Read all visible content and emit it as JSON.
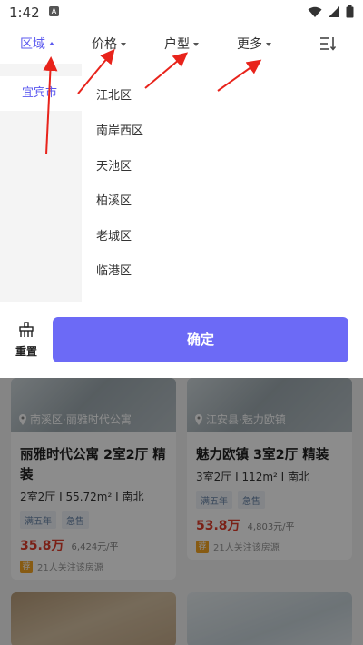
{
  "status_bar": {
    "time": "1:42",
    "app_icon": "A"
  },
  "filters": {
    "tabs": [
      {
        "label": "区域",
        "active": true
      },
      {
        "label": "价格",
        "active": false
      },
      {
        "label": "户型",
        "active": false
      },
      {
        "label": "更多",
        "active": false
      }
    ]
  },
  "region": {
    "city": "宜宾市",
    "districts": [
      "江北区",
      "南岸西区",
      "天池区",
      "柏溪区",
      "老城区",
      "临港区"
    ]
  },
  "actions": {
    "reset_label": "重置",
    "confirm_label": "确定"
  },
  "listings": [
    {
      "location": "南溪区·丽雅时代公寓",
      "title": "丽雅时代公寓 2室2厅 精装",
      "spec": "2室2厅 I 55.72m² I 南北",
      "tags": [
        "满五年",
        "急售"
      ],
      "price": "35.8万",
      "unit_price": "6,424元/平",
      "badge": "荐",
      "attention": "21人关注该房源"
    },
    {
      "location": "江安县·魅力欧镇",
      "title": "魅力欧镇 3室2厅 精装",
      "spec": "3室2厅 I 112m² I 南北",
      "tags": [
        "满五年",
        "急售"
      ],
      "price": "53.8万",
      "unit_price": "4,803元/平",
      "badge": "荐",
      "attention": "21人关注该房源"
    }
  ],
  "colors": {
    "accent": "#6c6af6",
    "active_text": "#5b59ef",
    "price": "#e03c2a",
    "annotation_arrow": "#e8231b"
  }
}
